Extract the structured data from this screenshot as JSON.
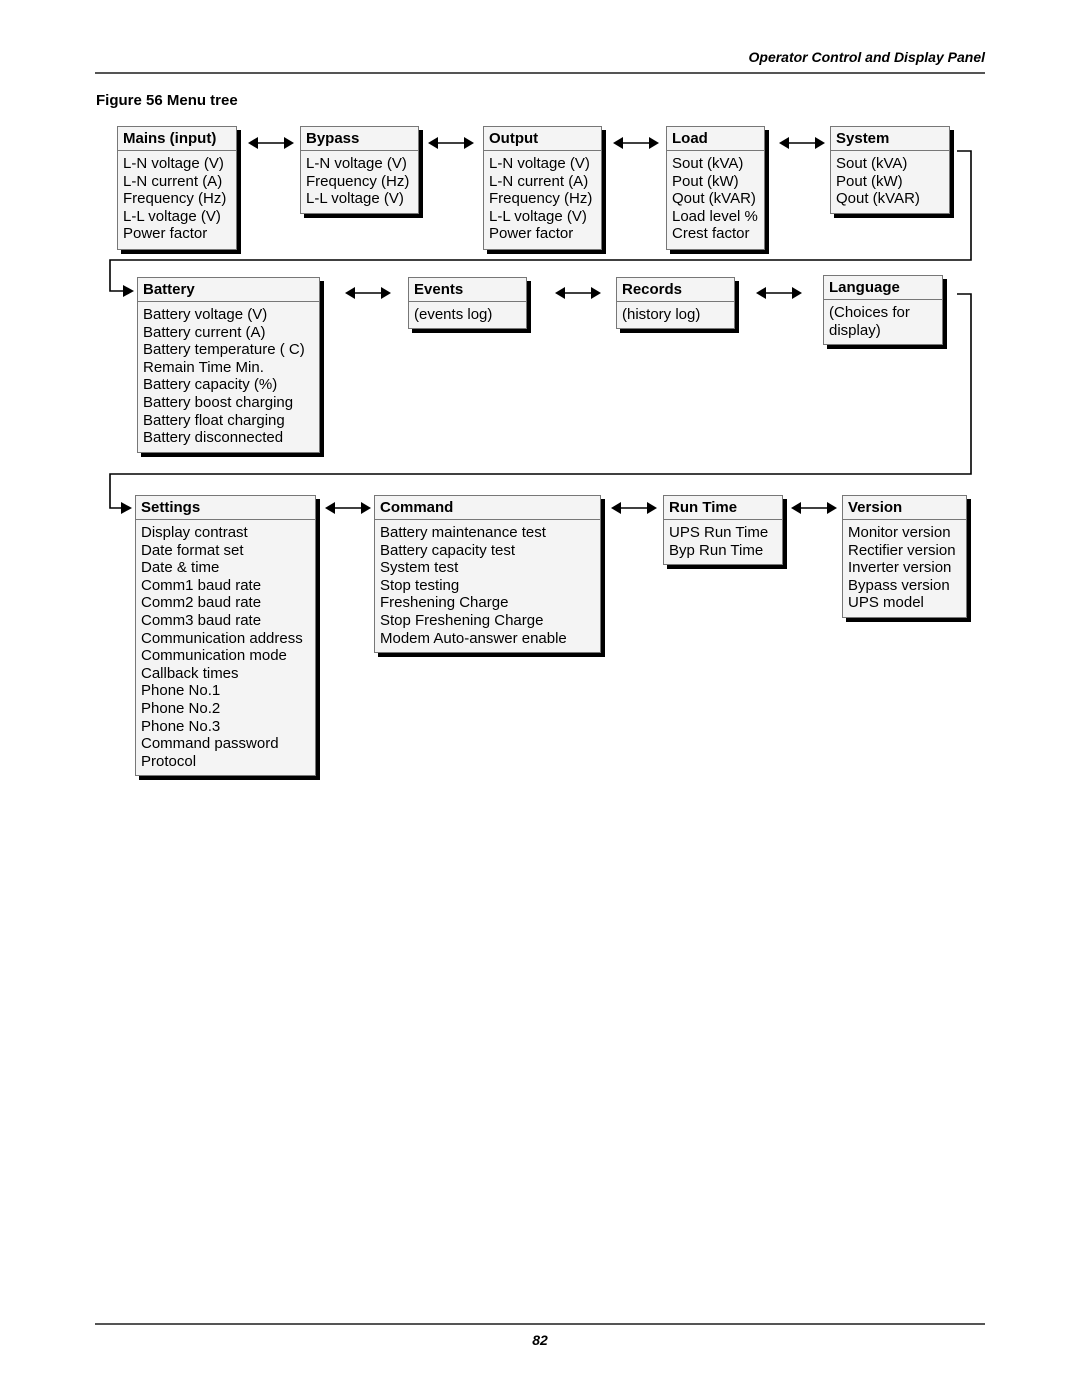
{
  "header": {
    "running_head": "Operator Control and Display Panel"
  },
  "figure": {
    "title": "Figure 56  Menu tree"
  },
  "footer": {
    "page_number": "82"
  },
  "menus": {
    "mains": {
      "title": "Mains (input)",
      "items": [
        "L-N voltage (V)",
        "L-N current (A)",
        "Frequency (Hz)",
        "L-L voltage (V)",
        "Power factor"
      ]
    },
    "bypass": {
      "title": "Bypass",
      "items": [
        "L-N voltage (V)",
        "Frequency (Hz)",
        "L-L voltage (V)"
      ]
    },
    "output": {
      "title": "Output",
      "items": [
        "L-N voltage (V)",
        "L-N current (A)",
        "Frequency (Hz)",
        "L-L voltage (V)",
        "Power factor"
      ]
    },
    "load": {
      "title": "Load",
      "items": [
        "Sout (kVA)",
        "Pout (kW)",
        "Qout (kVAR)",
        "Load level %",
        "Crest factor"
      ]
    },
    "system": {
      "title": "System",
      "items": [
        "Sout (kVA)",
        "Pout (kW)",
        "Qout (kVAR)"
      ]
    },
    "battery": {
      "title": "Battery",
      "items": [
        "Battery voltage (V)",
        "Battery current (A)",
        "Battery temperature ( C)",
        "Remain Time Min.",
        "Battery capacity (%)",
        "Battery boost charging",
        "Battery float charging",
        "Battery disconnected"
      ]
    },
    "events": {
      "title": "Events",
      "items": [
        "(events log)"
      ]
    },
    "records": {
      "title": "Records",
      "items": [
        "(history log)"
      ]
    },
    "language": {
      "title": "Language",
      "items": [
        "(Choices for display)"
      ]
    },
    "settings": {
      "title": "Settings",
      "items": [
        "Display contrast",
        "Date format set",
        "Date & time",
        "Comm1 baud rate",
        "Comm2 baud rate",
        "Comm3 baud rate",
        "Communication address",
        "Communication mode",
        "Callback times",
        "Phone No.1",
        "Phone No.2",
        "Phone No.3",
        "Command password",
        "Protocol"
      ]
    },
    "command": {
      "title": "Command",
      "items": [
        "Battery maintenance test",
        "Battery capacity test",
        "System test",
        "Stop testing",
        "Freshening Charge",
        "Stop Freshening Charge",
        "Modem Auto-answer enable"
      ]
    },
    "runtime": {
      "title": "Run Time",
      "items": [
        "UPS Run Time",
        "Byp Run Time"
      ]
    },
    "version": {
      "title": "Version",
      "items": [
        "Monitor version",
        "Rectifier version",
        "Inverter version",
        "Bypass version",
        "UPS model"
      ]
    }
  },
  "icons": {
    "bidirectional_arrow": "double-headed-arrow",
    "connector_arrow": "right-arrow"
  }
}
